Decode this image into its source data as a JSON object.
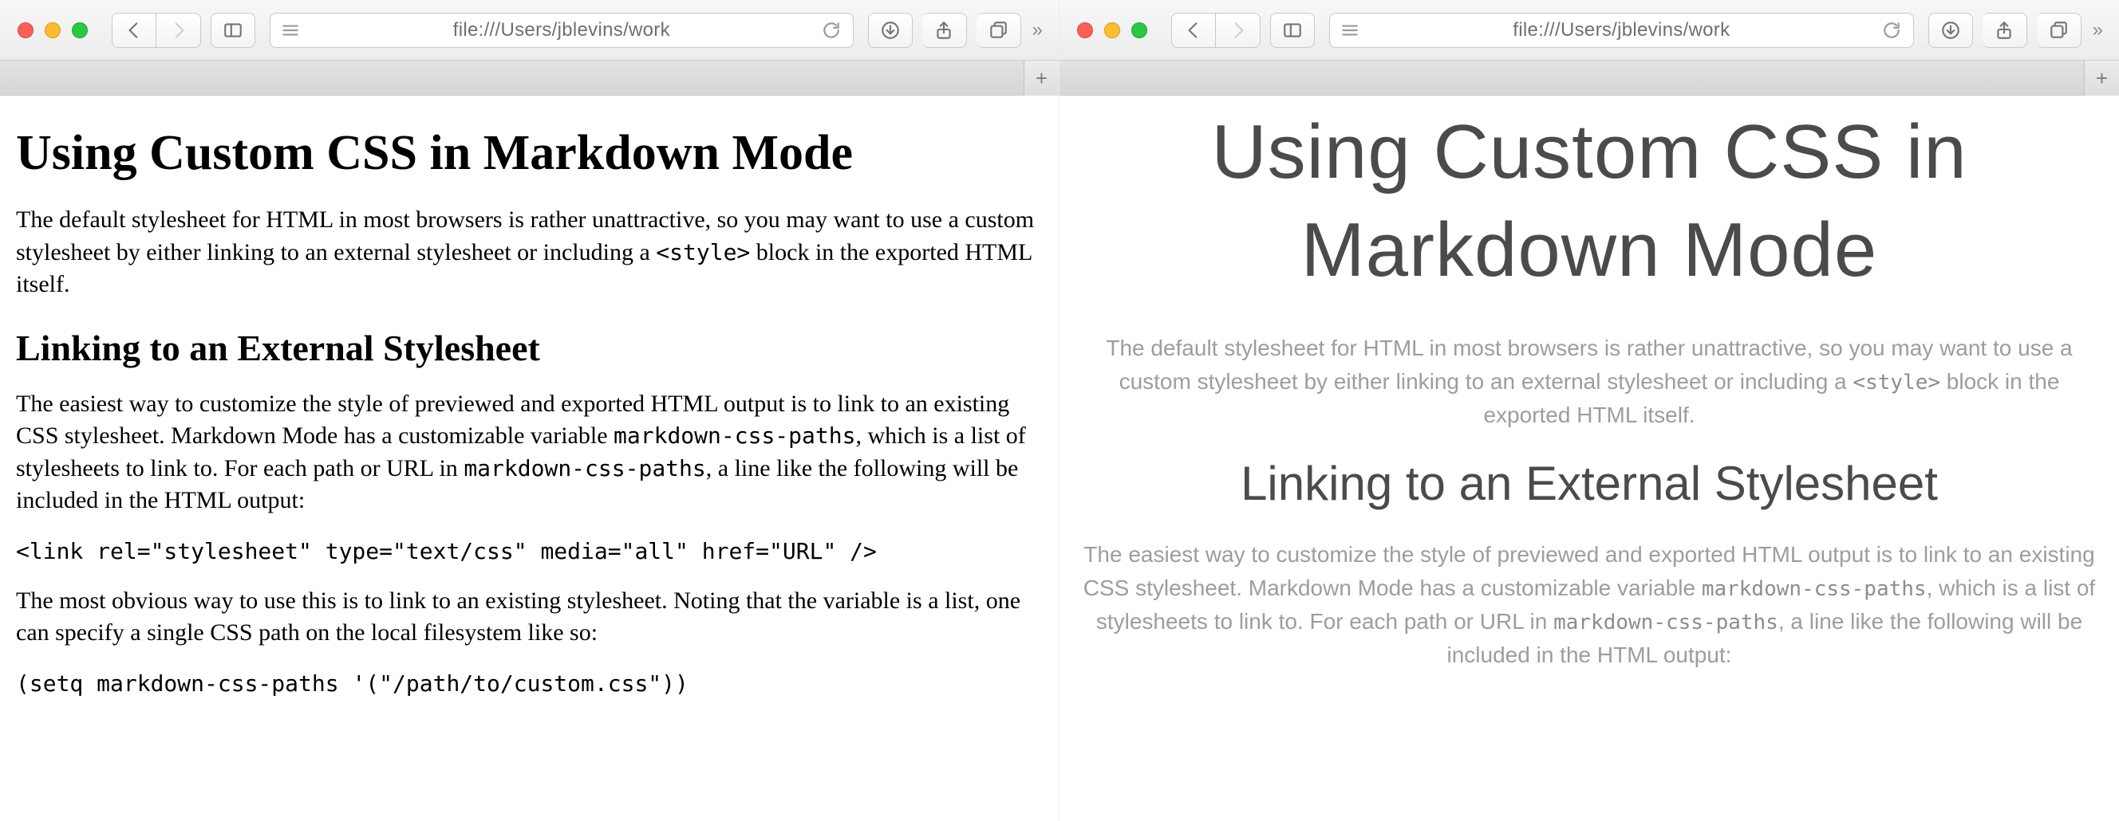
{
  "windows": [
    {
      "address_url": "file:///Users/jblevins/work",
      "newtab_label": "+",
      "chevrons": "»",
      "content": {
        "h1": "Using Custom CSS in Markdown Mode",
        "p1_a": "The default stylesheet for HTML in most browsers is rather unattractive, so you may want to use a custom stylesheet by either linking to an external stylesheet or including a ",
        "p1_code": "<style>",
        "p1_b": " block in the exported HTML itself.",
        "h2": "Linking to an External Stylesheet",
        "p2_a": "The easiest way to customize the style of previewed and exported HTML output is to link to an existing CSS stylesheet. Markdown Mode has a customizable variable ",
        "p2_code1": "markdown-css-paths",
        "p2_b": ", which is a list of stylesheets to link to. For each path or URL in ",
        "p2_code2": "markdown-css-paths",
        "p2_c": ", a line like the following will be included in the HTML output:",
        "codeblock1": "<link rel=\"stylesheet\" type=\"text/css\" media=\"all\" href=\"URL\" />",
        "p3": "The most obvious way to use this is to link to an existing stylesheet. Noting that the variable is a list, one can specify a single CSS path on the local filesystem like so:",
        "codeblock2": "(setq markdown-css-paths '(\"/path/to/custom.css\"))"
      }
    },
    {
      "address_url": "file:///Users/jblevins/work",
      "newtab_label": "+",
      "chevrons": "»",
      "content": {
        "h1": "Using Custom CSS in Markdown Mode",
        "p1_a": "The default stylesheet for HTML in most browsers is rather unattractive, so you may want to use a custom stylesheet by either linking to an external stylesheet or including a ",
        "p1_code": "<style>",
        "p1_b": " block in the exported HTML itself.",
        "h2": "Linking to an External Stylesheet",
        "p2_a": "The easiest way to customize the style of previewed and exported HTML output is to link to an existing CSS stylesheet. Markdown Mode has a customizable variable ",
        "p2_code1": "markdown-css-paths",
        "p2_b": ", which is a list of stylesheets to link to. For each path or URL in ",
        "p2_code2": "markdown-css-paths",
        "p2_c": ", a line like the following will be included in the HTML output:"
      }
    }
  ]
}
